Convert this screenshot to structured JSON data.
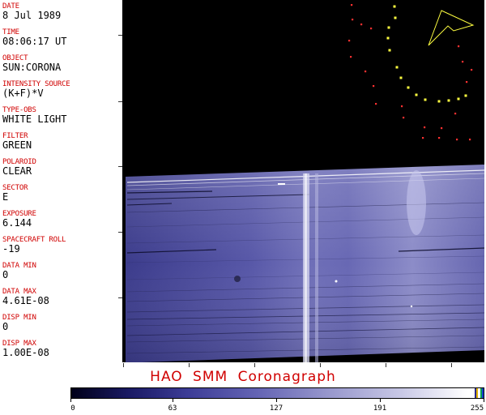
{
  "metadata": {
    "date": {
      "label": "DATE",
      "value": "8 Jul 1989"
    },
    "time": {
      "label": "TIME",
      "value": "08:06:17 UT"
    },
    "object": {
      "label": "OBJECT",
      "value": "SUN:CORONA"
    },
    "intensity_source": {
      "label": "INTENSITY SOURCE",
      "value": "(K+F)*V"
    },
    "type_obs": {
      "label": "TYPE-OBS",
      "value": "WHITE LIGHT"
    },
    "filter": {
      "label": "FILTER",
      "value": "GREEN"
    },
    "polaroid": {
      "label": "POLAROID",
      "value": "CLEAR"
    },
    "sector": {
      "label": "SECTOR",
      "value": "E"
    },
    "exposure": {
      "label": "EXPOSURE",
      "value": "6.144"
    },
    "spacecraft_roll": {
      "label": "SPACECRAFT ROLL",
      "value": "-19"
    },
    "data_min": {
      "label": "DATA MIN",
      "value": "0"
    },
    "data_max": {
      "label": "DATA MAX",
      "value": "4.61E-08"
    },
    "disp_min": {
      "label": "DISP MIN",
      "value": "0"
    },
    "disp_max": {
      "label": "DISP MAX",
      "value": "1.00E-08"
    }
  },
  "title": "HAO SMM Coronagraph",
  "colorbar": {
    "labels": [
      "0",
      "63",
      "127",
      "191",
      "255"
    ],
    "range": [
      0,
      255
    ],
    "cap_colors": [
      "#2a2a8a",
      "#e0b000",
      "#ffffff",
      "#00a050",
      "#1a3cd0"
    ]
  },
  "colors": {
    "label_red": "#d00000",
    "image_blue": "#4a4a9e",
    "overlay_yellow": "#ffff40",
    "overlay_red": "#ff3030"
  }
}
